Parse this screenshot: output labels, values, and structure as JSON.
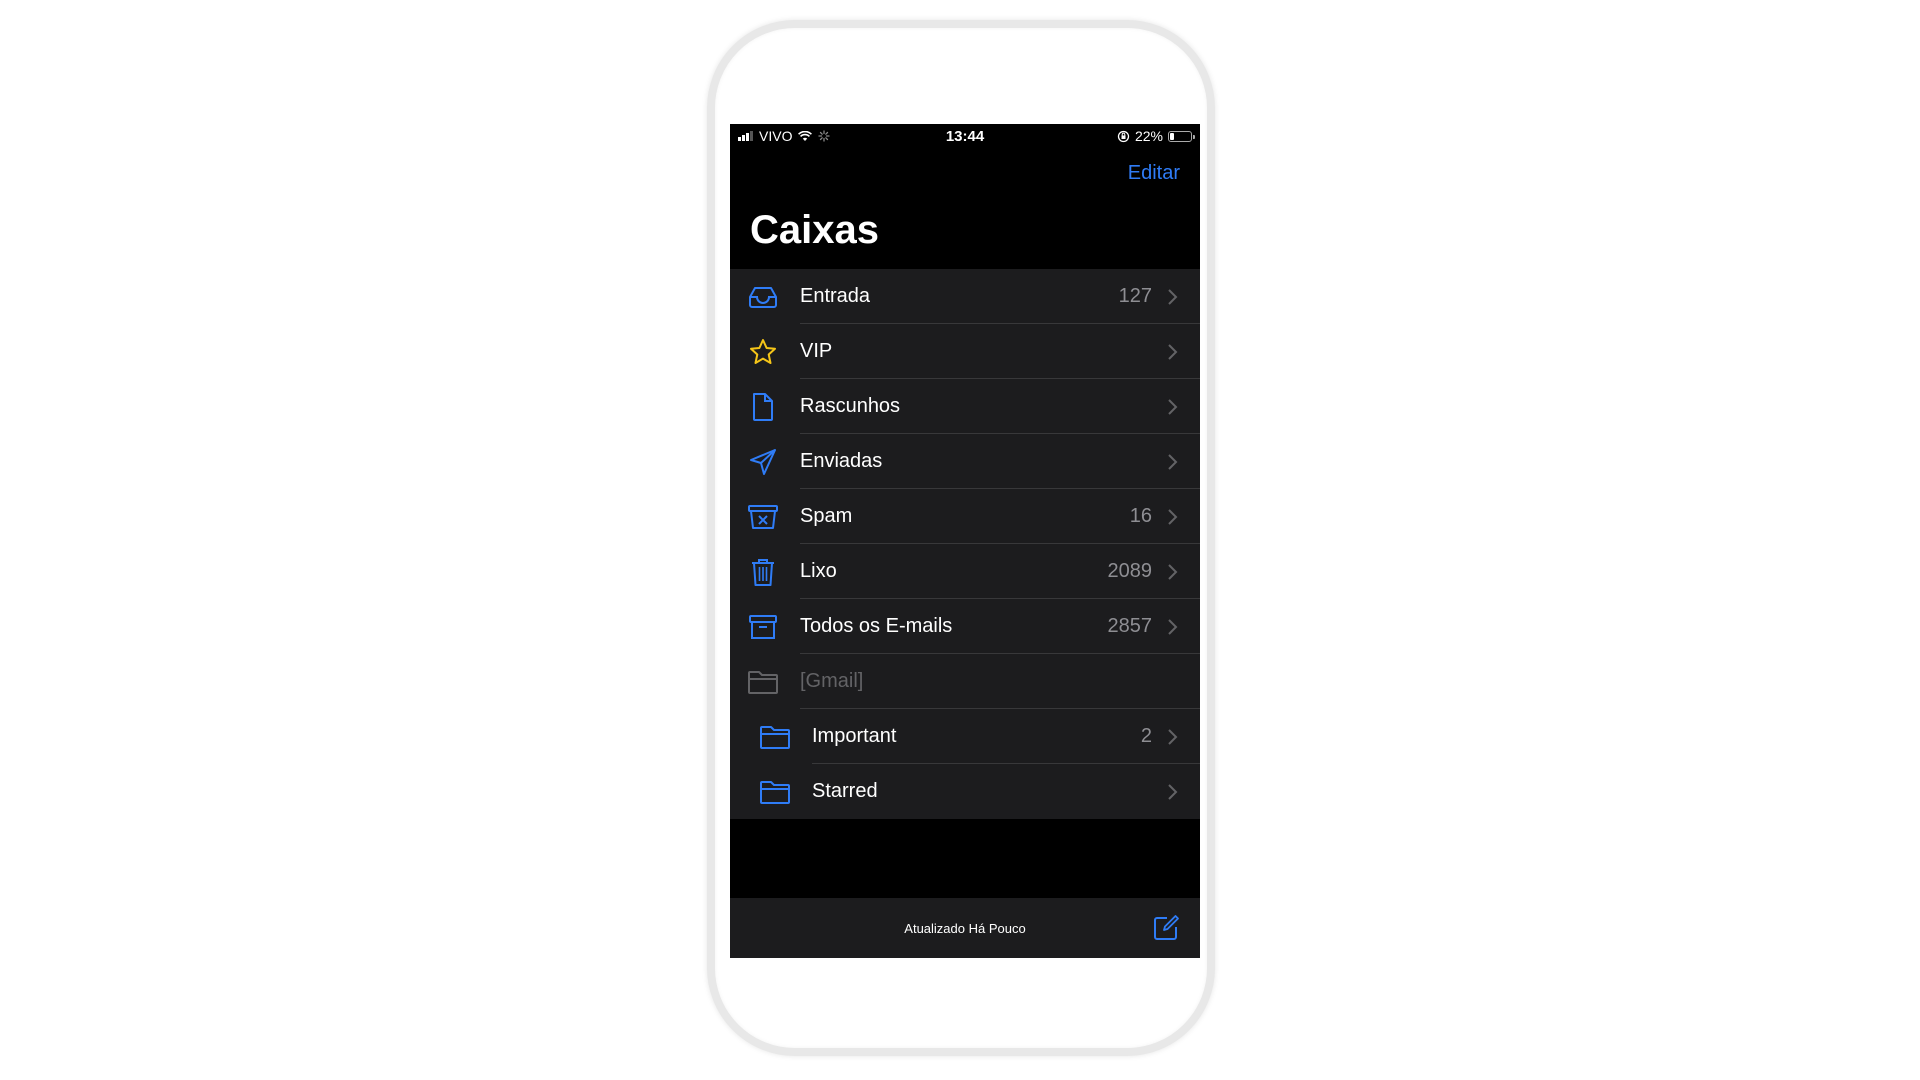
{
  "status_bar": {
    "carrier": "VIVO",
    "time": "13:44",
    "battery": "22%",
    "battery_level": 0.22
  },
  "nav": {
    "edit_label": "Editar",
    "title": "Caixas"
  },
  "mailboxes": [
    {
      "label": "Entrada",
      "count": "127",
      "icon": "inbox-icon"
    },
    {
      "label": "VIP",
      "count": "",
      "icon": "star-icon"
    },
    {
      "label": "Rascunhos",
      "count": "",
      "icon": "document-icon"
    },
    {
      "label": "Enviadas",
      "count": "",
      "icon": "paper-plane-icon"
    },
    {
      "label": "Spam",
      "count": "16",
      "icon": "junk-icon"
    },
    {
      "label": "Lixo",
      "count": "2089",
      "icon": "trash-icon"
    },
    {
      "label": "Todos os E-mails",
      "count": "2857",
      "icon": "archive-icon"
    },
    {
      "label": "[Gmail]",
      "count": "",
      "icon": "folder-icon"
    },
    {
      "label": "Important",
      "count": "2",
      "icon": "folder-icon"
    },
    {
      "label": "Starred",
      "count": "",
      "icon": "folder-icon"
    }
  ],
  "toolbar": {
    "status": "Atualizado Há Pouco"
  },
  "colors": {
    "accent": "#2f7cf6",
    "vip": "#f5c518",
    "background": "#000000",
    "cell": "#1c1c1e"
  }
}
